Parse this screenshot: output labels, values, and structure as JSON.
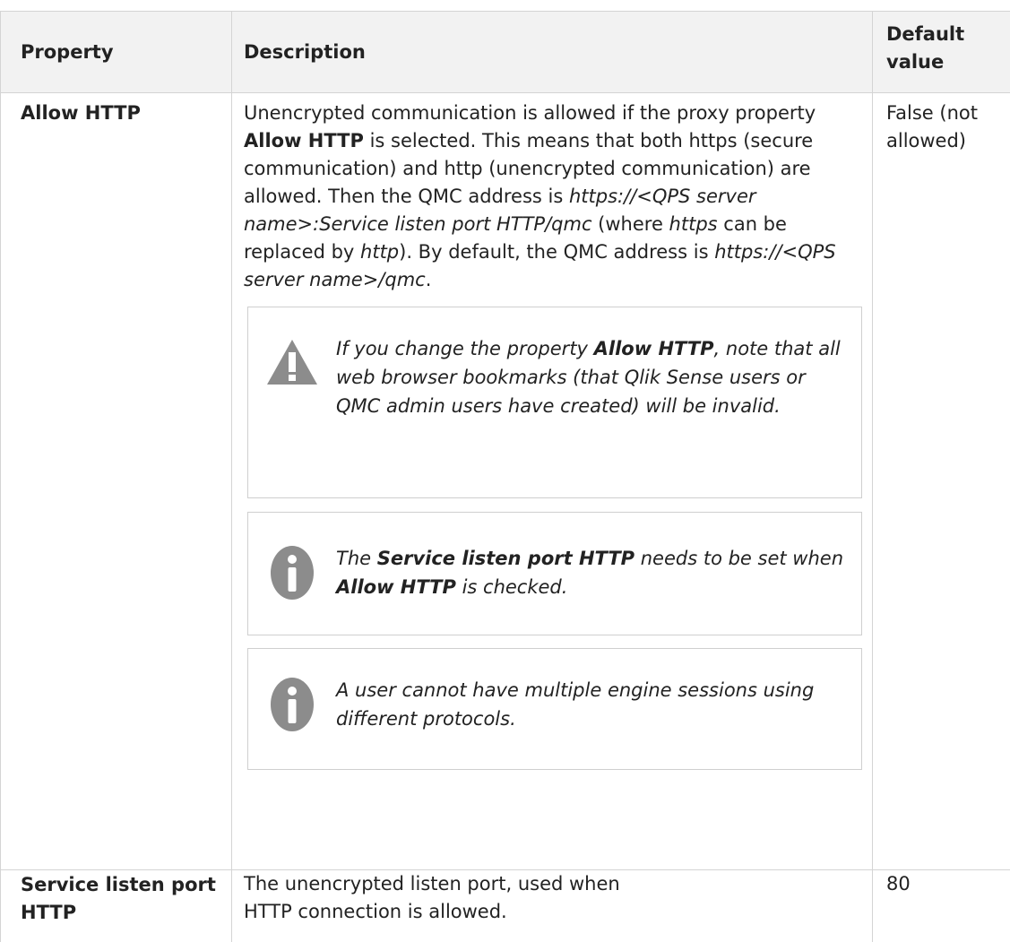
{
  "columns": {
    "property": "Property",
    "description": "Description",
    "default_value": "Default value"
  },
  "rows": [
    {
      "property": "Allow HTTP",
      "description": {
        "p1": "Unencrypted communication is allowed if the proxy property ",
        "p1_bold": "Allow HTTP",
        "p2": " is selected. This means that both https (secure communication) and http (unencrypted communication) are allowed. Then the QMC address is ",
        "p2_italic": "https://<QPS server name>:Service listen port HTTP/qmc",
        "p3": " (where ",
        "p3_italic": "https",
        "p4": " can be replaced by ",
        "p4_italic": "http",
        "p5": "). By default, the QMC address is ",
        "p5_italic": "https://<QPS server name>/qmc",
        "p6": "."
      },
      "notes": [
        {
          "type": "warning",
          "icon": "warning-icon",
          "t1": "If you change the property ",
          "t1_bold": "Allow HTTP",
          "t2": ", note that all web browser bookmarks (that Qlik Sense users or QMC admin users have created) will be invalid."
        },
        {
          "type": "info",
          "icon": "info-icon",
          "t1": "The ",
          "t1_bold": "Service listen port HTTP",
          "t2": " needs to be set when ",
          "t2_bold": "Allow HTTP",
          "t3": " is checked."
        },
        {
          "type": "info",
          "icon": "info-icon",
          "t1": "A user cannot have multiple engine sessions using different protocols."
        }
      ],
      "default_value": "False (not allowed)"
    },
    {
      "property": "Service listen port HTTP",
      "description_plain": {
        "line1": "The unencrypted listen port, used when",
        "line2": "HTTP connection is allowed."
      },
      "default_value": "80"
    }
  ],
  "colors": {
    "header_bg": "#f2f2f2",
    "border": "#d4d4d4",
    "icon_gray": "#8c8c8c",
    "text": "#222222"
  }
}
